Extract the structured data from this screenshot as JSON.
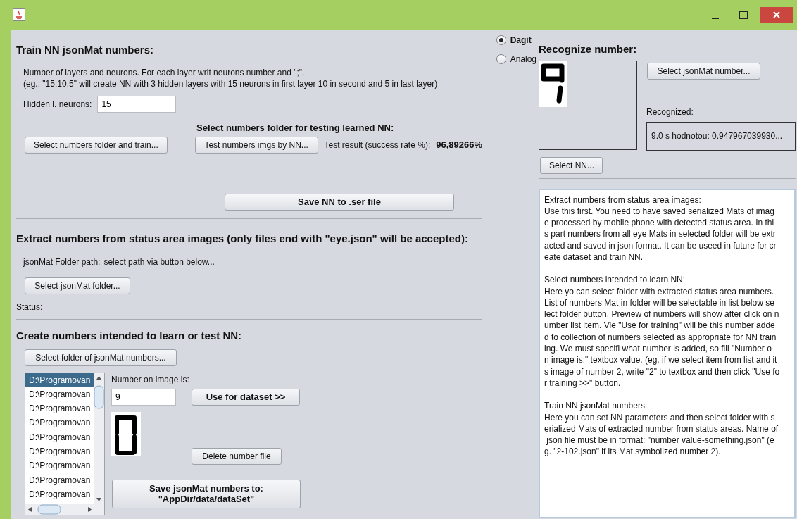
{
  "modes": [
    {
      "label": "Dagit",
      "selected": true
    },
    {
      "label": "Analog",
      "selected": false
    }
  ],
  "train": {
    "title": "Train NN jsonMat numbers:",
    "description": [
      "Number of layers and neurons. For each layer writ neurons number and \";\".",
      "(eg.: \"15;10,5\" will create NN with 3 hidden layers with 15 neurons in first layer 10 in second and 5 in last layer)"
    ],
    "hidden_label": "Hidden l. neurons:",
    "hidden_value": "15",
    "test_heading": "Select numbers folder for testing learned NN:",
    "train_button": "Select numbers folder and train...",
    "test_button": "Test numbers imgs by NN...",
    "test_result_label": "Test result (success rate %):",
    "test_result_value": "96,89266%",
    "save_button": "Save NN to .ser file"
  },
  "extract": {
    "title": "Extract numbers from status area images (only files end with \"eye.json\" will be accepted):",
    "path_label": "jsonMat Folder path:",
    "path_value": "select path via button below...",
    "folder_button": "Select jsonMat folder...",
    "status_label": "Status:"
  },
  "create": {
    "title": "Create numbers intended to learn or test NN:",
    "folder_button": "Select folder of jsonMat numbers...",
    "files": [
      {
        "label": "D:\\Programovan",
        "selected": true
      },
      {
        "label": "D:\\Programovan",
        "selected": false
      },
      {
        "label": "D:\\Programovan",
        "selected": false
      },
      {
        "label": "D:\\Programovan",
        "selected": false
      },
      {
        "label": "D:\\Programovan",
        "selected": false
      },
      {
        "label": "D:\\Programovan",
        "selected": false
      },
      {
        "label": "D:\\Programovan",
        "selected": false
      },
      {
        "label": "D:\\Programovan",
        "selected": false
      },
      {
        "label": "D:\\Programovan",
        "selected": false
      }
    ],
    "number_label": "Number on image is:",
    "number_value": "9",
    "use_button": "Use for dataset >>",
    "delete_button": "Delete number file",
    "save_button": "Save jsonMat numbers to:\n\"AppDir/data/dataSet\""
  },
  "recognize": {
    "title": "Recognize number:",
    "select_number_button": "Select jsonMat number...",
    "recognized_label": "Recognized:",
    "recognized_value": "9.0 s hodnotou: 0.947967039930...",
    "select_nn_button": "Select NN..."
  },
  "help": {
    "paragraphs": [
      [
        "Extract numbers from status area images:",
        "Use this first. You need to have saved serialized Mats of imag",
        "e processed by mobile phone with detected status area. In thi",
        "s part numbers from all eye Mats in selected folder will be extr",
        "acted and saved in json format. It can be useed in future for cr",
        "eate dataset and train NN."
      ],
      [
        "Select numbers intended to learn NN:",
        "Here yo can select folder with extracted status area numbers.",
        "List of numbers Mat in folder will be selectable in list below se",
        "lect folder button. Preview of numbers will show after click on n",
        "umber list item. Vie \"Use for training\" will be this number adde",
        "d to collection of numbers selected as appropriate for NN train",
        "ing. We must specifi what number is added, so fill \"Number o",
        "n image is:\" textbox value. (eg. if we select item from list and it",
        "s image of number 2, write \"2\" to textbox and then click \"Use fo",
        "r training >>\" button."
      ],
      [
        "Train NN jsonMat numbers:",
        "Here you can set NN parameters and then select folder with s",
        "erialized Mats of extracted number from status areas. Name of",
        " json file must be in format: \"number value-something.json\" (e",
        "g. \"2-102.json\" if its Mat symbolized number 2)."
      ]
    ]
  }
}
